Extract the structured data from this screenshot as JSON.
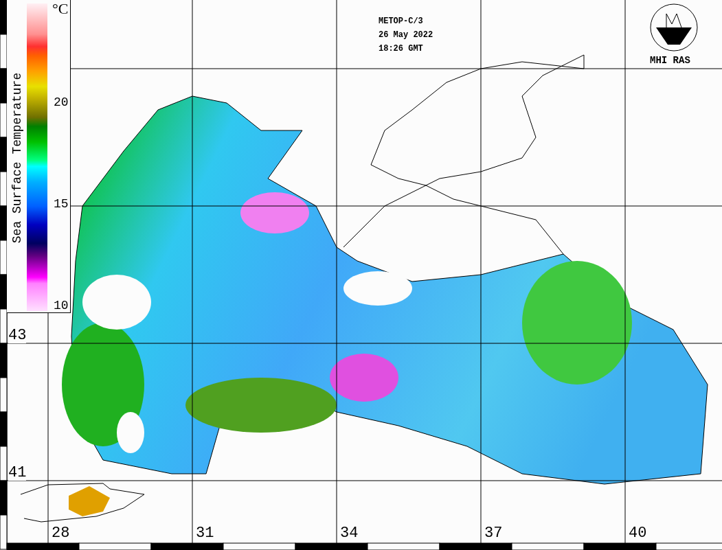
{
  "title_block": {
    "lines": [
      "METOP-C/3",
      "26 May 2022",
      "18:26 GMT"
    ]
  },
  "logo": {
    "label": "MHI RAS"
  },
  "legend": {
    "title": "Sea Surface Temperature",
    "unit": "°C",
    "ticks": [
      "20",
      "15",
      "10"
    ]
  },
  "map": {
    "latitude_labels": [
      "43",
      "41"
    ],
    "longitude_labels": [
      "28",
      "31",
      "34",
      "37",
      "40"
    ]
  }
}
